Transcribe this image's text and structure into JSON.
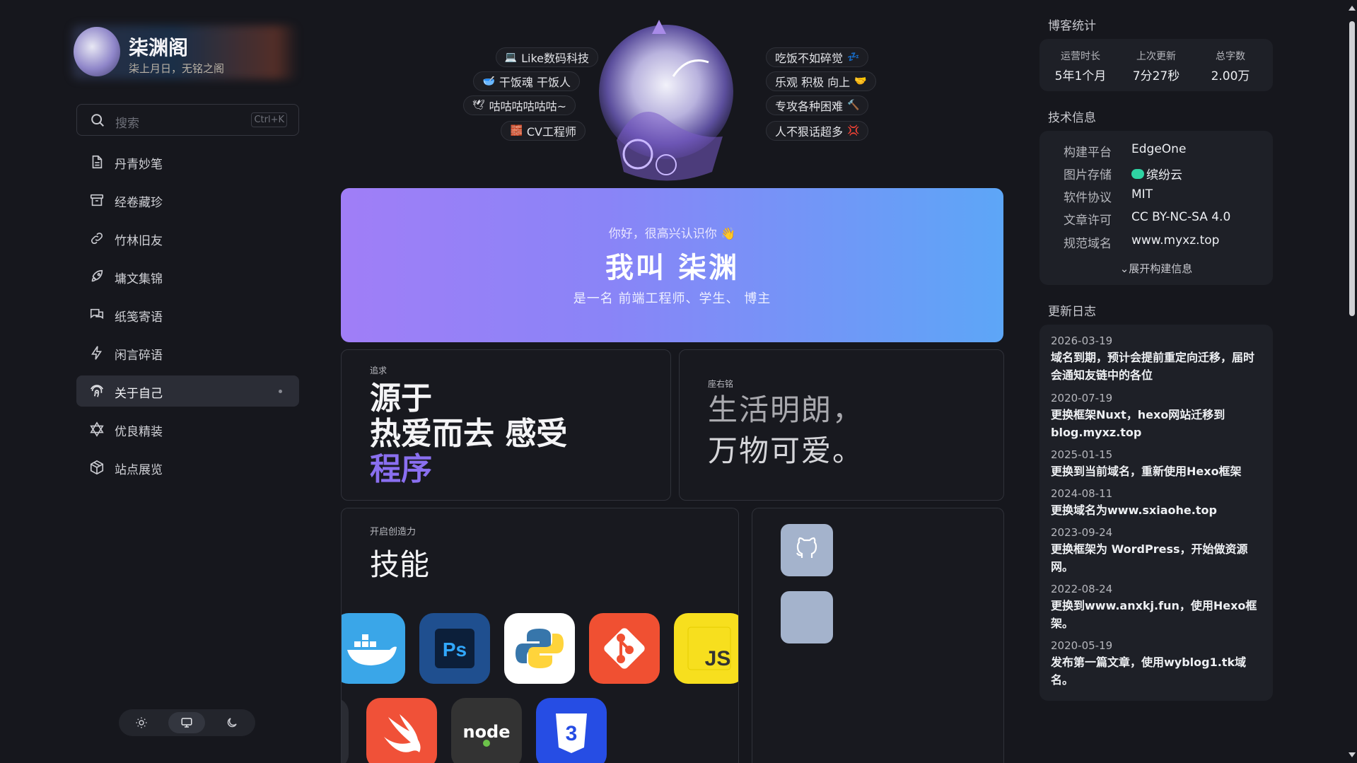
{
  "brand": {
    "name": "柒渊阁",
    "tagline": "柒上月日，无铭之阁"
  },
  "search": {
    "placeholder": "搜索",
    "shortcut": "Ctrl+K"
  },
  "nav": [
    {
      "label": "丹青妙笔",
      "icon": "document-icon"
    },
    {
      "label": "经卷藏珍",
      "icon": "archive-icon"
    },
    {
      "label": "竹林旧友",
      "icon": "link-icon"
    },
    {
      "label": "墉文集锦",
      "icon": "rocket-icon"
    },
    {
      "label": "纸笺寄语",
      "icon": "chat-icon"
    },
    {
      "label": "闲言碎语",
      "icon": "bolt-icon"
    },
    {
      "label": "关于自己",
      "icon": "fingerprint-icon",
      "active": true
    },
    {
      "label": "优良精装",
      "icon": "star-of-david-icon"
    },
    {
      "label": "站点展览",
      "icon": "cube-icon"
    }
  ],
  "theme": {
    "options": [
      "light",
      "system",
      "dark"
    ],
    "selected": "system"
  },
  "tags_left": [
    {
      "text": "Like数码科技",
      "emoji": "💻"
    },
    {
      "text": "干饭魂 干饭人",
      "emoji": "🥣"
    },
    {
      "text": "咕咕咕咕咕咕~",
      "emoji": "🕊"
    },
    {
      "text": "CV工程师",
      "emoji": "🧱"
    }
  ],
  "tags_right": [
    {
      "text": "吃饭不如碎觉",
      "emoji": "💤"
    },
    {
      "text": "乐观 积极 向上",
      "emoji": "🤝"
    },
    {
      "text": "专攻各种困难",
      "emoji": "🔨"
    },
    {
      "text": "人不狠话超多",
      "emoji": "💢"
    }
  ],
  "hello": {
    "greeting": "你好，很高兴认识你 👋",
    "name": "我叫 柒渊",
    "desc": "是一名 前端工程师、学生、 博主"
  },
  "pursue": {
    "label": "追求",
    "line1": "源于",
    "line2": "热爱而去 感受",
    "line3": "程序"
  },
  "motto": {
    "label": "座右铭",
    "line1": "生活明朗，",
    "line2": "万物可爱。"
  },
  "skills": {
    "label": "开启创造力",
    "title": "技能",
    "icons": [
      "docker-icon",
      "photoshop-icon",
      "python-icon",
      "git-icon",
      "javascript-icon",
      "swift-icon",
      "nodejs-icon",
      "css3-icon"
    ],
    "colors": {
      "docker": "#2496ed",
      "photoshop": "#1f4f8f",
      "python": "#ffffff",
      "git": "#f05032",
      "javascript": "#f7df1e",
      "swift": "#f05138",
      "node": "#333333",
      "css3": "#264de4"
    }
  },
  "right": {
    "stats_title": "博客统计",
    "stats": [
      {
        "k": "运营时长",
        "v": "5年1个月"
      },
      {
        "k": "上次更新",
        "v": "7分27秒"
      },
      {
        "k": "总字数",
        "v": "2.00万"
      }
    ],
    "tech_title": "技术信息",
    "tech": [
      {
        "k": "构建平台",
        "v": "EdgeOne"
      },
      {
        "k": "图片存储",
        "v": "缤纷云"
      },
      {
        "k": "软件协议",
        "v": "MIT"
      },
      {
        "k": "文章许可",
        "v": "CC BY-NC-SA 4.0"
      },
      {
        "k": "规范域名",
        "v": "www.myxz.top"
      }
    ],
    "expand": "展开构建信息",
    "log_title": "更新日志",
    "logs": [
      {
        "date": "2026-03-19",
        "text": "域名到期，预计会提前重定向迁移，届时会通知友链中的各位"
      },
      {
        "date": "2020-07-19",
        "text": "更换框架Nuxt，hexo网站迁移到blog.myxz.top"
      },
      {
        "date": "2025-01-15",
        "text": "更换到当前域名，重新使用Hexo框架"
      },
      {
        "date": "2024-08-11",
        "text": "更换域名为www.sxiaohe.top"
      },
      {
        "date": "2023-09-24",
        "text": "更换框架为 WordPress，开始做资源网。"
      },
      {
        "date": "2022-08-24",
        "text": "更换到www.anxkj.fun，使用Hexo框架。"
      },
      {
        "date": "2020-05-19",
        "text": "发布第一篇文章，使用wyblog1.tk域名。"
      }
    ]
  }
}
